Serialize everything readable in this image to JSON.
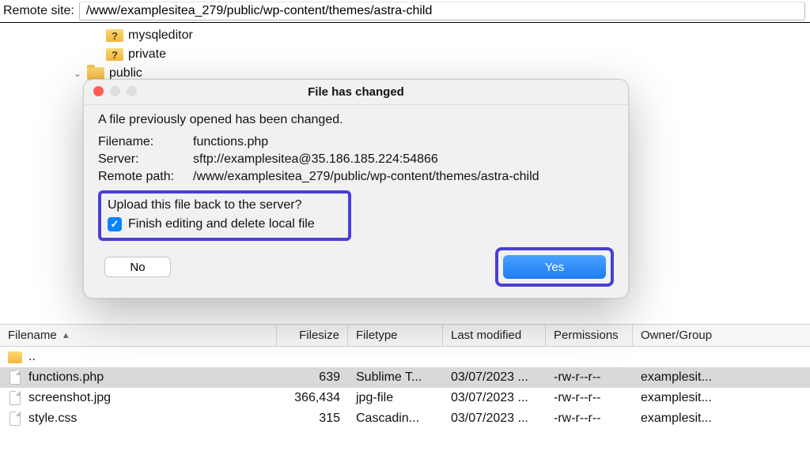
{
  "topbar": {
    "label": "Remote site:",
    "path": "/www/examplesitea_279/public/wp-content/themes/astra-child"
  },
  "tree": {
    "items": [
      {
        "name": "mysqleditor",
        "kind": "unknown"
      },
      {
        "name": "private",
        "kind": "unknown"
      },
      {
        "name": "public",
        "kind": "folder",
        "expanded": true,
        "cut": true
      }
    ]
  },
  "columns": {
    "filename": "Filename",
    "filesize": "Filesize",
    "filetype": "Filetype",
    "modified": "Last modified",
    "permissions": "Permissions",
    "owner": "Owner/Group",
    "sort": "asc"
  },
  "files": {
    "up": "..",
    "rows": [
      {
        "name": "functions.php",
        "size": "639",
        "type": "Sublime T...",
        "mod": "03/07/2023 ...",
        "perm": "-rw-r--r--",
        "own": "examplesit...",
        "selected": true
      },
      {
        "name": "screenshot.jpg",
        "size": "366,434",
        "type": "jpg-file",
        "mod": "03/07/2023 ...",
        "perm": "-rw-r--r--",
        "own": "examplesit..."
      },
      {
        "name": "style.css",
        "size": "315",
        "type": "Cascadin...",
        "mod": "03/07/2023 ...",
        "perm": "-rw-r--r--",
        "own": "examplesit..."
      }
    ]
  },
  "dialog": {
    "title": "File has changed",
    "message": "A file previously opened has been changed.",
    "filename_label": "Filename:",
    "filename": "functions.php",
    "server_label": "Server:",
    "server": "sftp://examplesitea@35.186.185.224:54866",
    "remote_label": "Remote path:",
    "remote": "/www/examplesitea_279/public/wp-content/themes/astra-child",
    "question": "Upload this file back to the server?",
    "checkbox_label": "Finish editing and delete local file",
    "checkbox_checked": true,
    "btn_no": "No",
    "btn_yes": "Yes"
  }
}
